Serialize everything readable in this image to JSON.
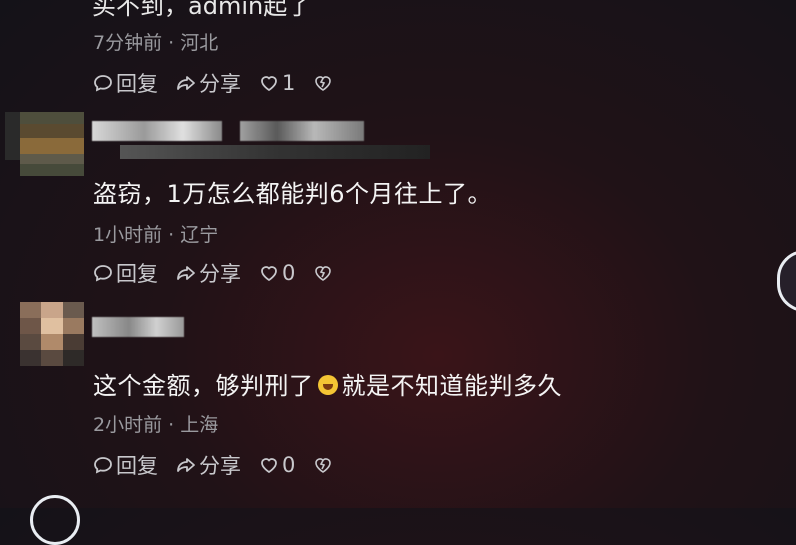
{
  "top_partial_text": "买不到，admin起了",
  "comments": [
    {
      "text": "",
      "meta": "7分钟前 · 河北",
      "reply": "回复",
      "share": "分享",
      "likes": "1"
    },
    {
      "text": "盗窃，1万怎么都能判6个月往上了。",
      "meta": "1小时前 · 辽宁",
      "reply": "回复",
      "share": "分享",
      "likes": "0"
    },
    {
      "text_before": "这个金额，够判刑了",
      "text_after": "就是不知道能判多久",
      "meta": "2小时前 · 上海",
      "reply": "回复",
      "share": "分享",
      "likes": "0"
    }
  ],
  "colors": {
    "bg": "#1a1418",
    "muted": "#9a9a9f",
    "text": "#f4f4f4"
  },
  "icons": [
    "comment-icon",
    "share-icon",
    "heart-icon",
    "dislike-icon",
    "laugh-emoji-icon"
  ]
}
